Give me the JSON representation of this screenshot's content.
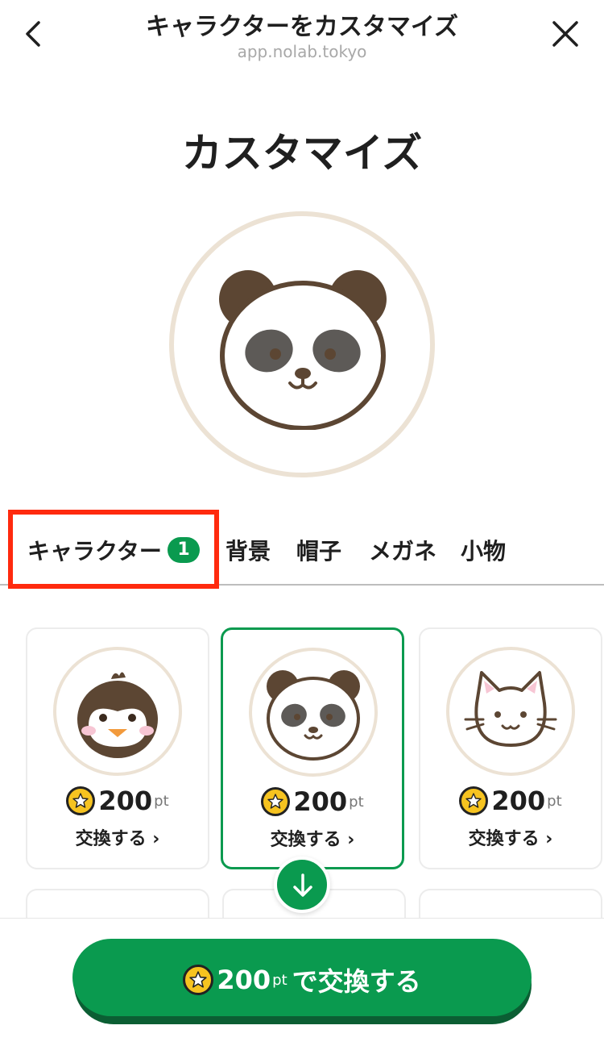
{
  "topbar": {
    "title": "キャラクターをカスタマイズ",
    "url": "app.nolab.tokyo",
    "back_icon": "chevron-left-icon",
    "close_icon": "close-icon"
  },
  "page": {
    "title": "カスタマイズ"
  },
  "preview": {
    "character": "panda"
  },
  "tabs": [
    {
      "label": "キャラクター",
      "badge": "1",
      "selected": true
    },
    {
      "label": "背景"
    },
    {
      "label": "帽子"
    },
    {
      "label": "メガネ"
    },
    {
      "label": "小物"
    }
  ],
  "items": [
    {
      "character": "penguin",
      "price": "200",
      "unit": "pt",
      "action": "交換する ›"
    },
    {
      "character": "panda",
      "price": "200",
      "unit": "pt",
      "action": "交換する ›",
      "selected": true
    },
    {
      "character": "cat",
      "price": "200",
      "unit": "pt",
      "action": "交換する ›"
    }
  ],
  "cta": {
    "price": "200",
    "unit": "pt",
    "label": "で交換する"
  },
  "colors": {
    "accent": "#0a9a4f",
    "highlight": "#ff2a0e",
    "coin": "#f6c320",
    "ring": "#ece2d4"
  }
}
